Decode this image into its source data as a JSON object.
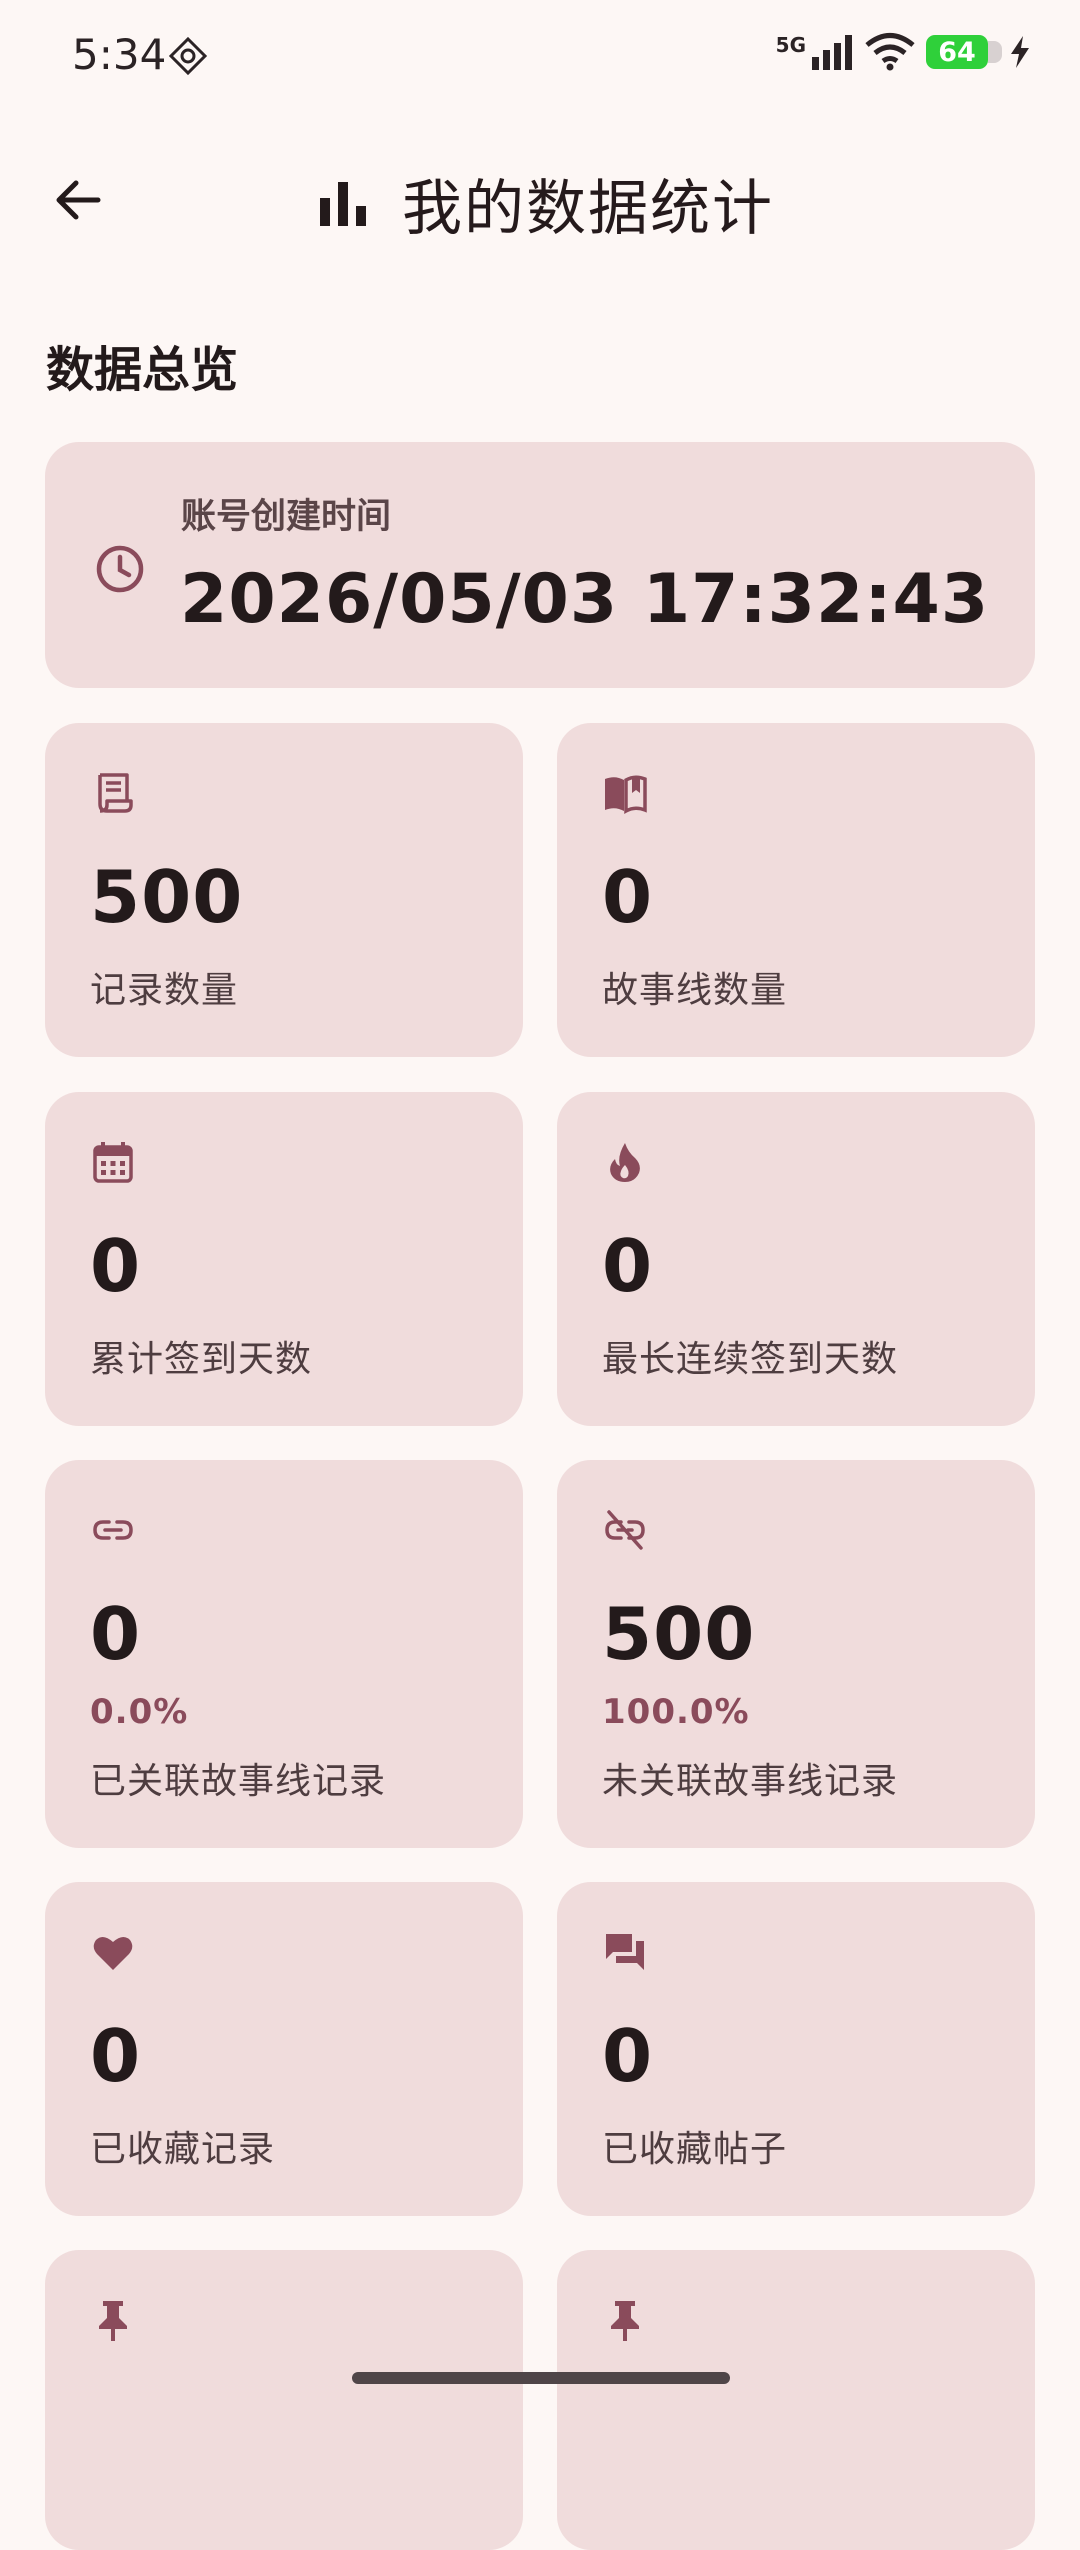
{
  "status_bar": {
    "time": "5:34",
    "network": "5G",
    "battery": "64"
  },
  "app_bar": {
    "title": "我的数据统计"
  },
  "section": {
    "title": "数据总览"
  },
  "account": {
    "label": "账号创建时间",
    "value": "2026/05/03 17:32:43"
  },
  "stats": [
    {
      "icon": "receipt-icon",
      "value": "500",
      "label": "记录数量"
    },
    {
      "icon": "book-icon",
      "value": "0",
      "label": "故事线数量"
    },
    {
      "icon": "calendar-icon",
      "value": "0",
      "label": "累计签到天数"
    },
    {
      "icon": "fire-icon",
      "value": "0",
      "label": "最长连续签到天数"
    },
    {
      "icon": "link-icon",
      "value": "0",
      "percent": "0.0%",
      "label": "已关联故事线记录"
    },
    {
      "icon": "link-off-icon",
      "value": "500",
      "percent": "100.0%",
      "label": "未关联故事线记录"
    },
    {
      "icon": "heart-icon",
      "value": "0",
      "label": "已收藏记录"
    },
    {
      "icon": "forum-icon",
      "value": "0",
      "label": "已收藏帖子"
    },
    {
      "icon": "pin-icon"
    },
    {
      "icon": "pin-icon"
    }
  ],
  "colors": {
    "background": "#fdf7f5",
    "card": "#f0dcdc",
    "accent": "#8a4b5b",
    "battery": "#2fd03a"
  }
}
